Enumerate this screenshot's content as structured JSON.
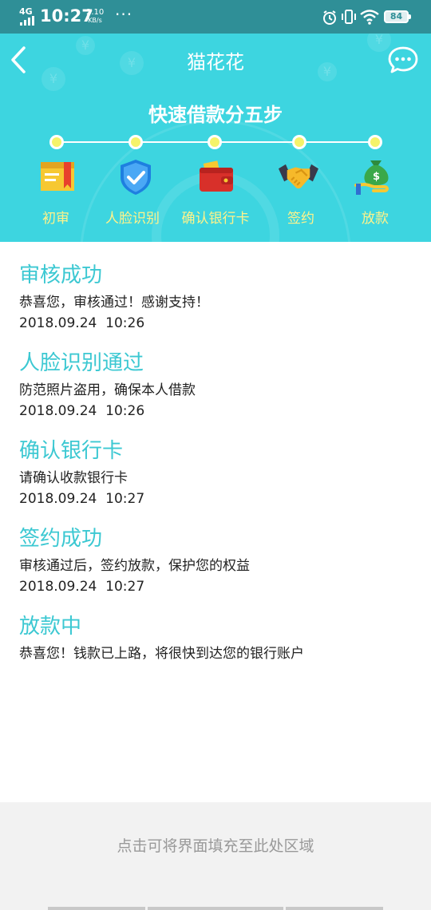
{
  "status_bar": {
    "network": "4G",
    "time": "10:27",
    "speed_value": "2.10",
    "speed_unit": "KB/s",
    "dots": "···",
    "battery": "84"
  },
  "nav": {
    "title": "猫花花"
  },
  "steps": {
    "heading": "快速借款分五步",
    "items": [
      {
        "label": "初审",
        "icon": "document-icon"
      },
      {
        "label": "人脸识别",
        "icon": "shield-check-icon"
      },
      {
        "label": "确认银行卡",
        "icon": "wallet-icon"
      },
      {
        "label": "签约",
        "icon": "handshake-icon"
      },
      {
        "label": "放款",
        "icon": "money-bag-icon"
      }
    ]
  },
  "entries": [
    {
      "title": "审核成功",
      "desc": "恭喜您，审核通过！感谢支持！",
      "time": "2018.09.24  10:26"
    },
    {
      "title": "人脸识别通过",
      "desc": "防范照片盗用，确保本人借款",
      "time": "2018.09.24  10:26"
    },
    {
      "title": "确认银行卡",
      "desc": "请确认收款银行卡",
      "time": "2018.09.24  10:27"
    },
    {
      "title": "签约成功",
      "desc": "审核通过后，签约放款，保护您的权益",
      "time": "2018.09.24  10:27"
    },
    {
      "title": "放款中",
      "desc": "恭喜您！钱款已上路，将很快到达您的银行账户"
    }
  ],
  "fill_area": {
    "hint": "点击可将界面填充至此处区域"
  },
  "colors": {
    "header_bg": "#3dd5e0",
    "status_bg": "#2f8f97",
    "title_text": "#3cc8d2",
    "step_label": "#fff38a",
    "step_dot": "#f5f36a"
  }
}
